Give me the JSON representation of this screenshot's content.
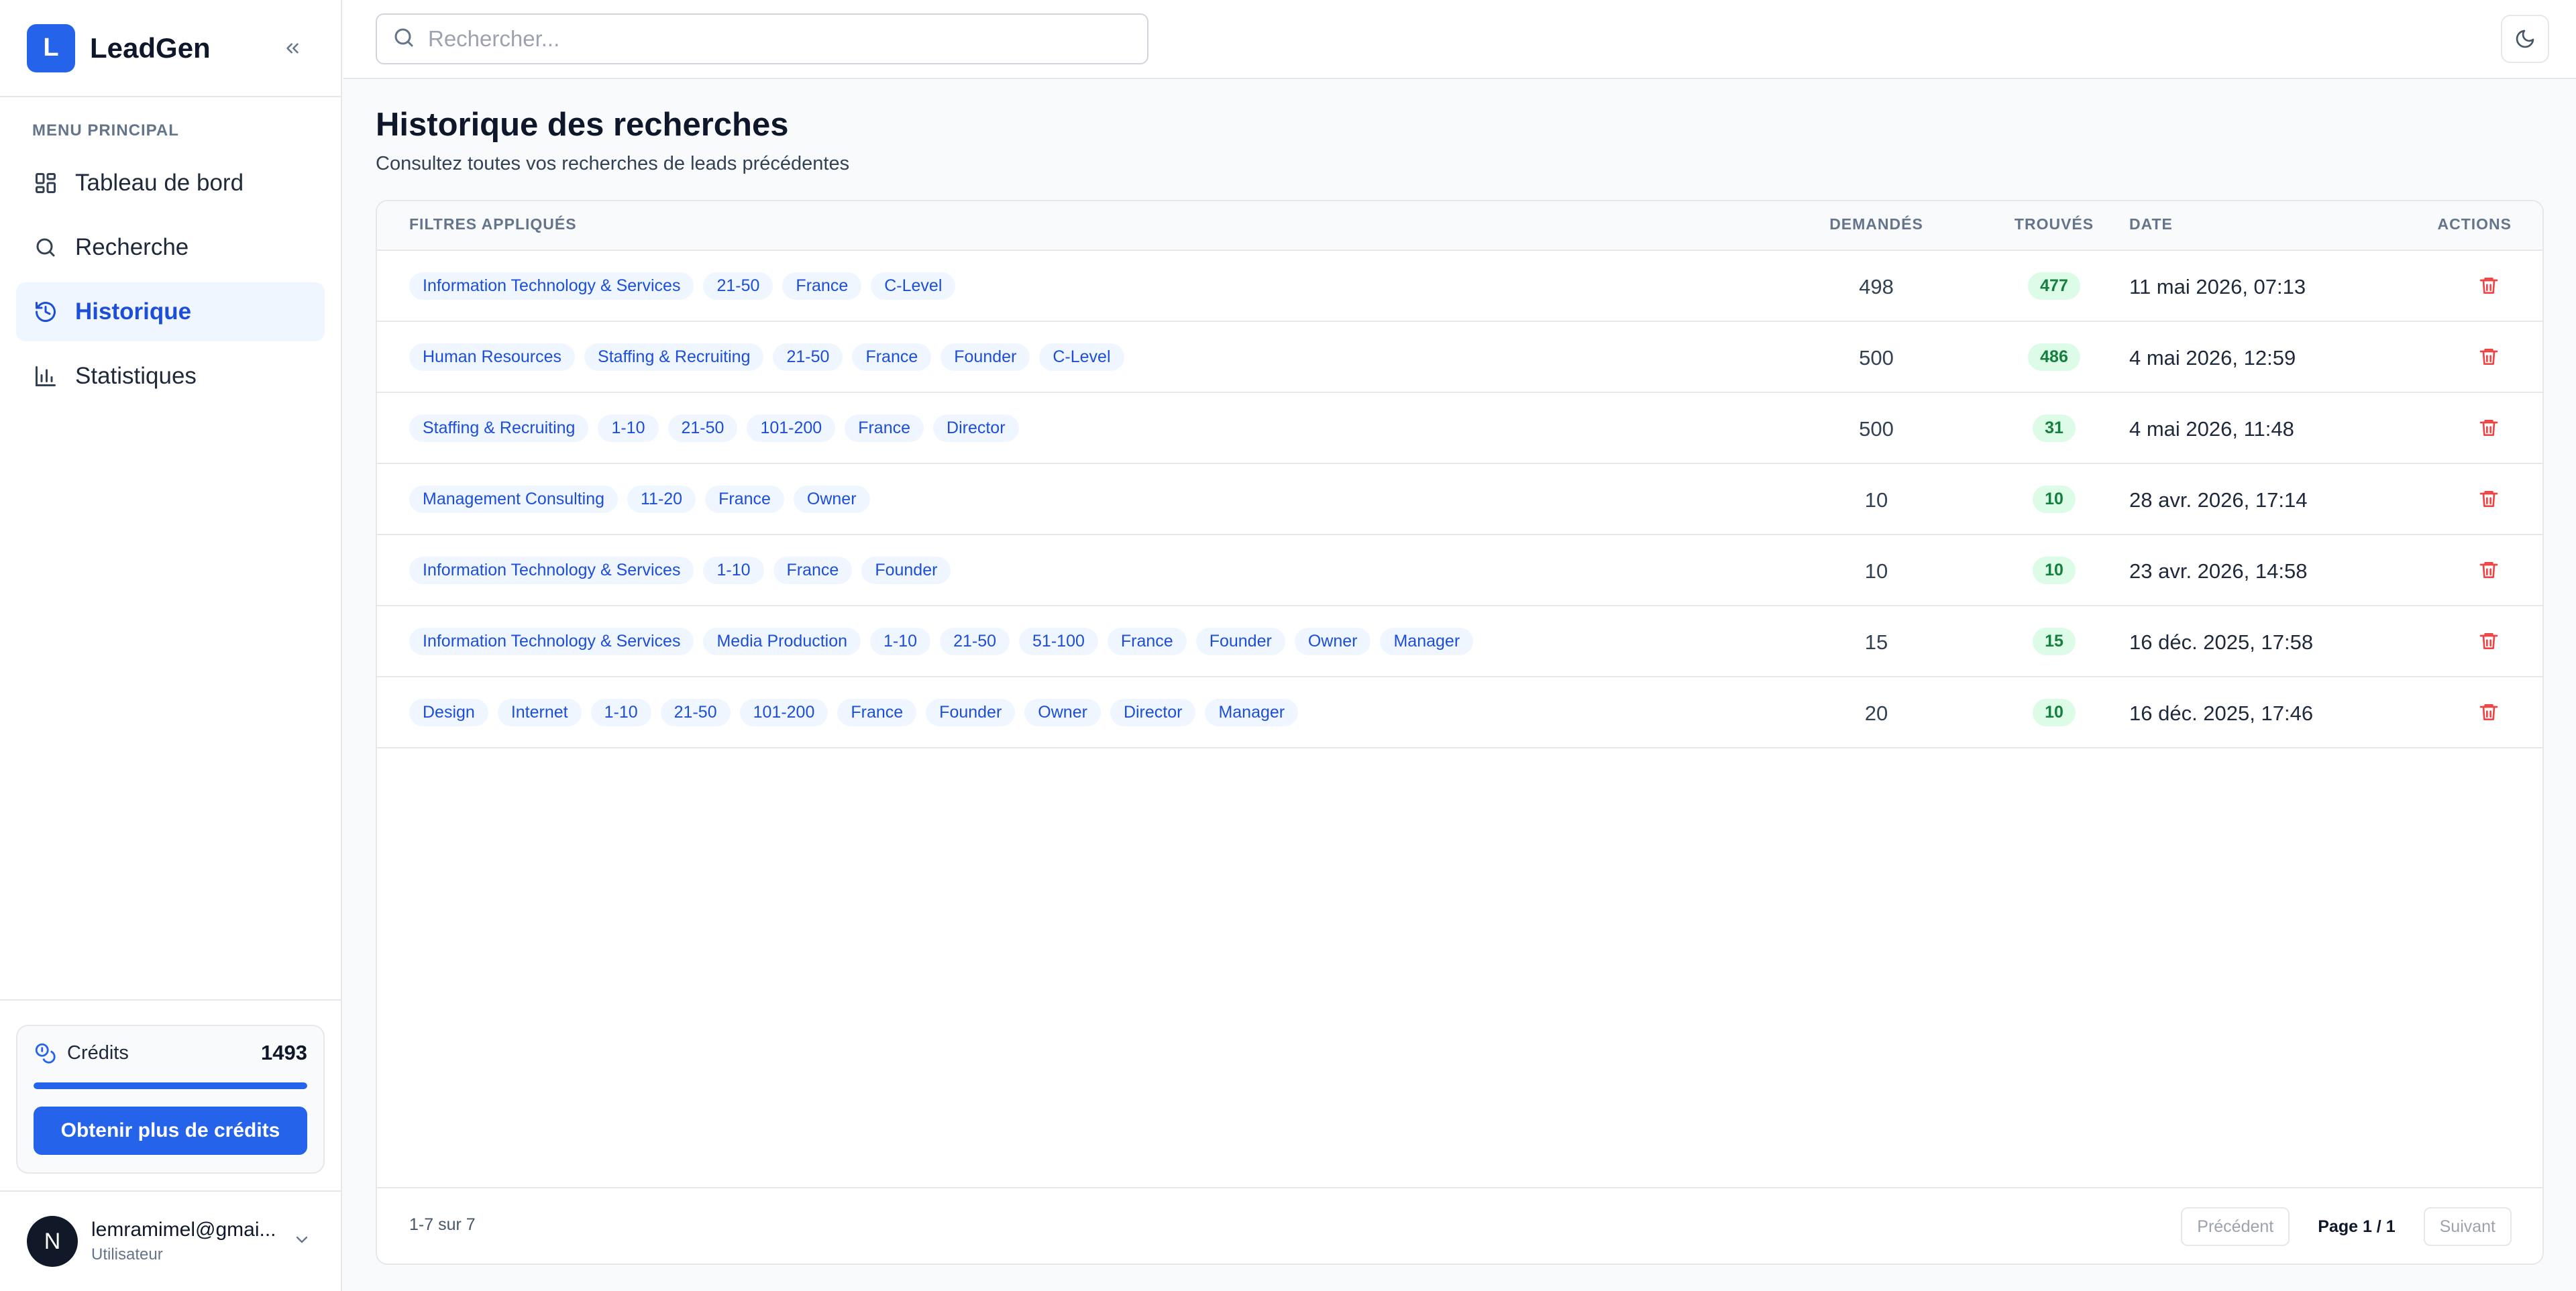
{
  "brand": {
    "logo_letter": "L",
    "name": "LeadGen"
  },
  "sidebar": {
    "heading": "MENU PRINCIPAL",
    "items": [
      {
        "label": "Tableau de bord",
        "icon": "dashboard-icon"
      },
      {
        "label": "Recherche",
        "icon": "search-icon"
      },
      {
        "label": "Historique",
        "icon": "history-icon",
        "active": true
      },
      {
        "label": "Statistiques",
        "icon": "bar-chart-icon"
      }
    ]
  },
  "credits": {
    "label": "Crédits",
    "value": "1493",
    "progress_fraction": 1.0,
    "button": "Obtenir plus de crédits"
  },
  "user": {
    "avatar_letter": "N",
    "email": "lemramimel@gmai...",
    "role": "Utilisateur"
  },
  "search": {
    "placeholder": "Rechercher..."
  },
  "page": {
    "title": "Historique des recherches",
    "subtitle": "Consultez toutes vos recherches de leads précédentes"
  },
  "table": {
    "headers": {
      "filters": "FILTRES APPLIQUÉS",
      "requested": "DEMANDÉS",
      "found": "TROUVÉS",
      "date": "DATE",
      "actions": "ACTIONS"
    },
    "rows": [
      {
        "filters": [
          "Information Technology & Services",
          "21-50",
          "France",
          "C-Level"
        ],
        "requested": "498",
        "found": "477",
        "date": "11 mai 2026, 07:13"
      },
      {
        "filters": [
          "Human Resources",
          "Staffing & Recruiting",
          "21-50",
          "France",
          "Founder",
          "C-Level"
        ],
        "requested": "500",
        "found": "486",
        "date": "4 mai 2026, 12:59"
      },
      {
        "filters": [
          "Staffing & Recruiting",
          "1-10",
          "21-50",
          "101-200",
          "France",
          "Director"
        ],
        "requested": "500",
        "found": "31",
        "date": "4 mai 2026, 11:48"
      },
      {
        "filters": [
          "Management Consulting",
          "11-20",
          "France",
          "Owner"
        ],
        "requested": "10",
        "found": "10",
        "date": "28 avr. 2026, 17:14"
      },
      {
        "filters": [
          "Information Technology & Services",
          "1-10",
          "France",
          "Founder"
        ],
        "requested": "10",
        "found": "10",
        "date": "23 avr. 2026, 14:58"
      },
      {
        "filters": [
          "Information Technology & Services",
          "Media Production",
          "1-10",
          "21-50",
          "51-100",
          "France",
          "Founder",
          "Owner",
          "Manager"
        ],
        "requested": "15",
        "found": "15",
        "date": "16 déc. 2025, 17:58"
      },
      {
        "filters": [
          "Design",
          "Internet",
          "1-10",
          "21-50",
          "101-200",
          "France",
          "Founder",
          "Owner",
          "Director",
          "Manager"
        ],
        "requested": "20",
        "found": "10",
        "date": "16 déc. 2025, 17:46"
      }
    ]
  },
  "pagination": {
    "count": "1-7 sur 7",
    "prev": "Précédent",
    "page_info": "Page 1 / 1",
    "next": "Suivant"
  },
  "colors": {
    "accent": "#2563eb",
    "chip_bg": "#eff6ff",
    "found_bg": "#dcfce7",
    "delete": "#ef4444"
  }
}
